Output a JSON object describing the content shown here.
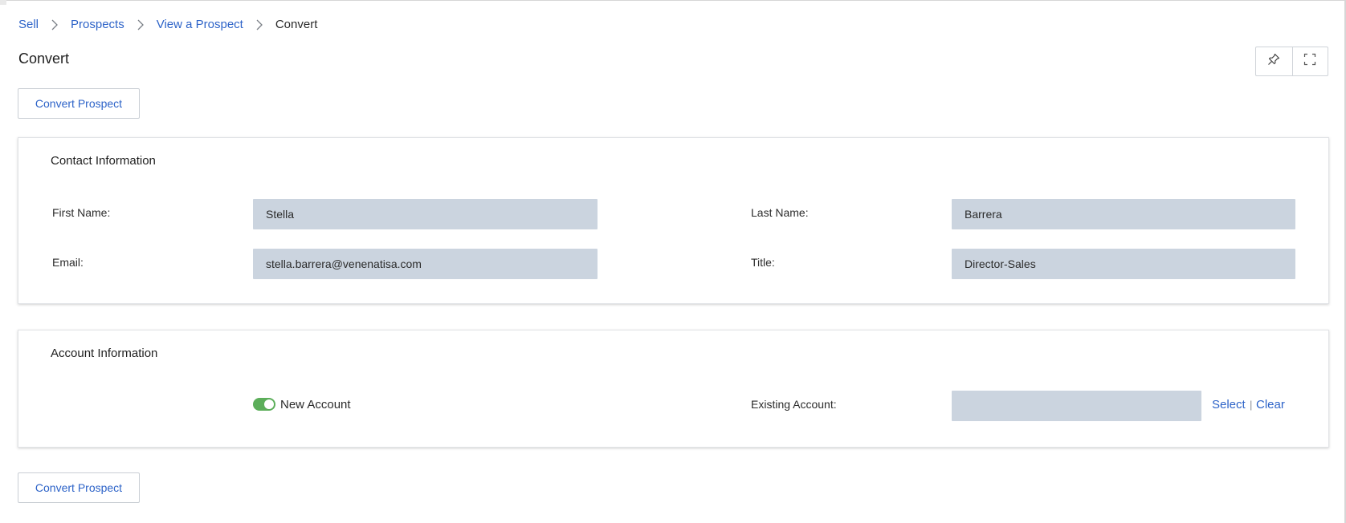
{
  "breadcrumb": {
    "items": [
      "Sell",
      "Prospects",
      "View a Prospect"
    ],
    "current": "Convert"
  },
  "page": {
    "title": "Convert"
  },
  "toolbar": {
    "pin_icon": "pin-icon",
    "expand_icon": "fullscreen-icon"
  },
  "actions": {
    "convert_label": "Convert Prospect"
  },
  "contact": {
    "heading": "Contact Information",
    "first_name_label": "First Name:",
    "first_name_value": "Stella",
    "last_name_label": "Last Name:",
    "last_name_value": "Barrera",
    "email_label": "Email:",
    "email_value": "stella.barrera@venenatisa.com",
    "title_label": "Title:",
    "title_value": "Director-Sales"
  },
  "account": {
    "heading": "Account Information",
    "new_account_label": "New Account",
    "new_account_on": true,
    "existing_label": "Existing Account:",
    "existing_value": "",
    "select_label": "Select",
    "separator": "|",
    "clear_label": "Clear"
  },
  "colors": {
    "link": "#2d63c8",
    "field_bg": "#cbd4df",
    "toggle_on": "#5cae5a"
  }
}
